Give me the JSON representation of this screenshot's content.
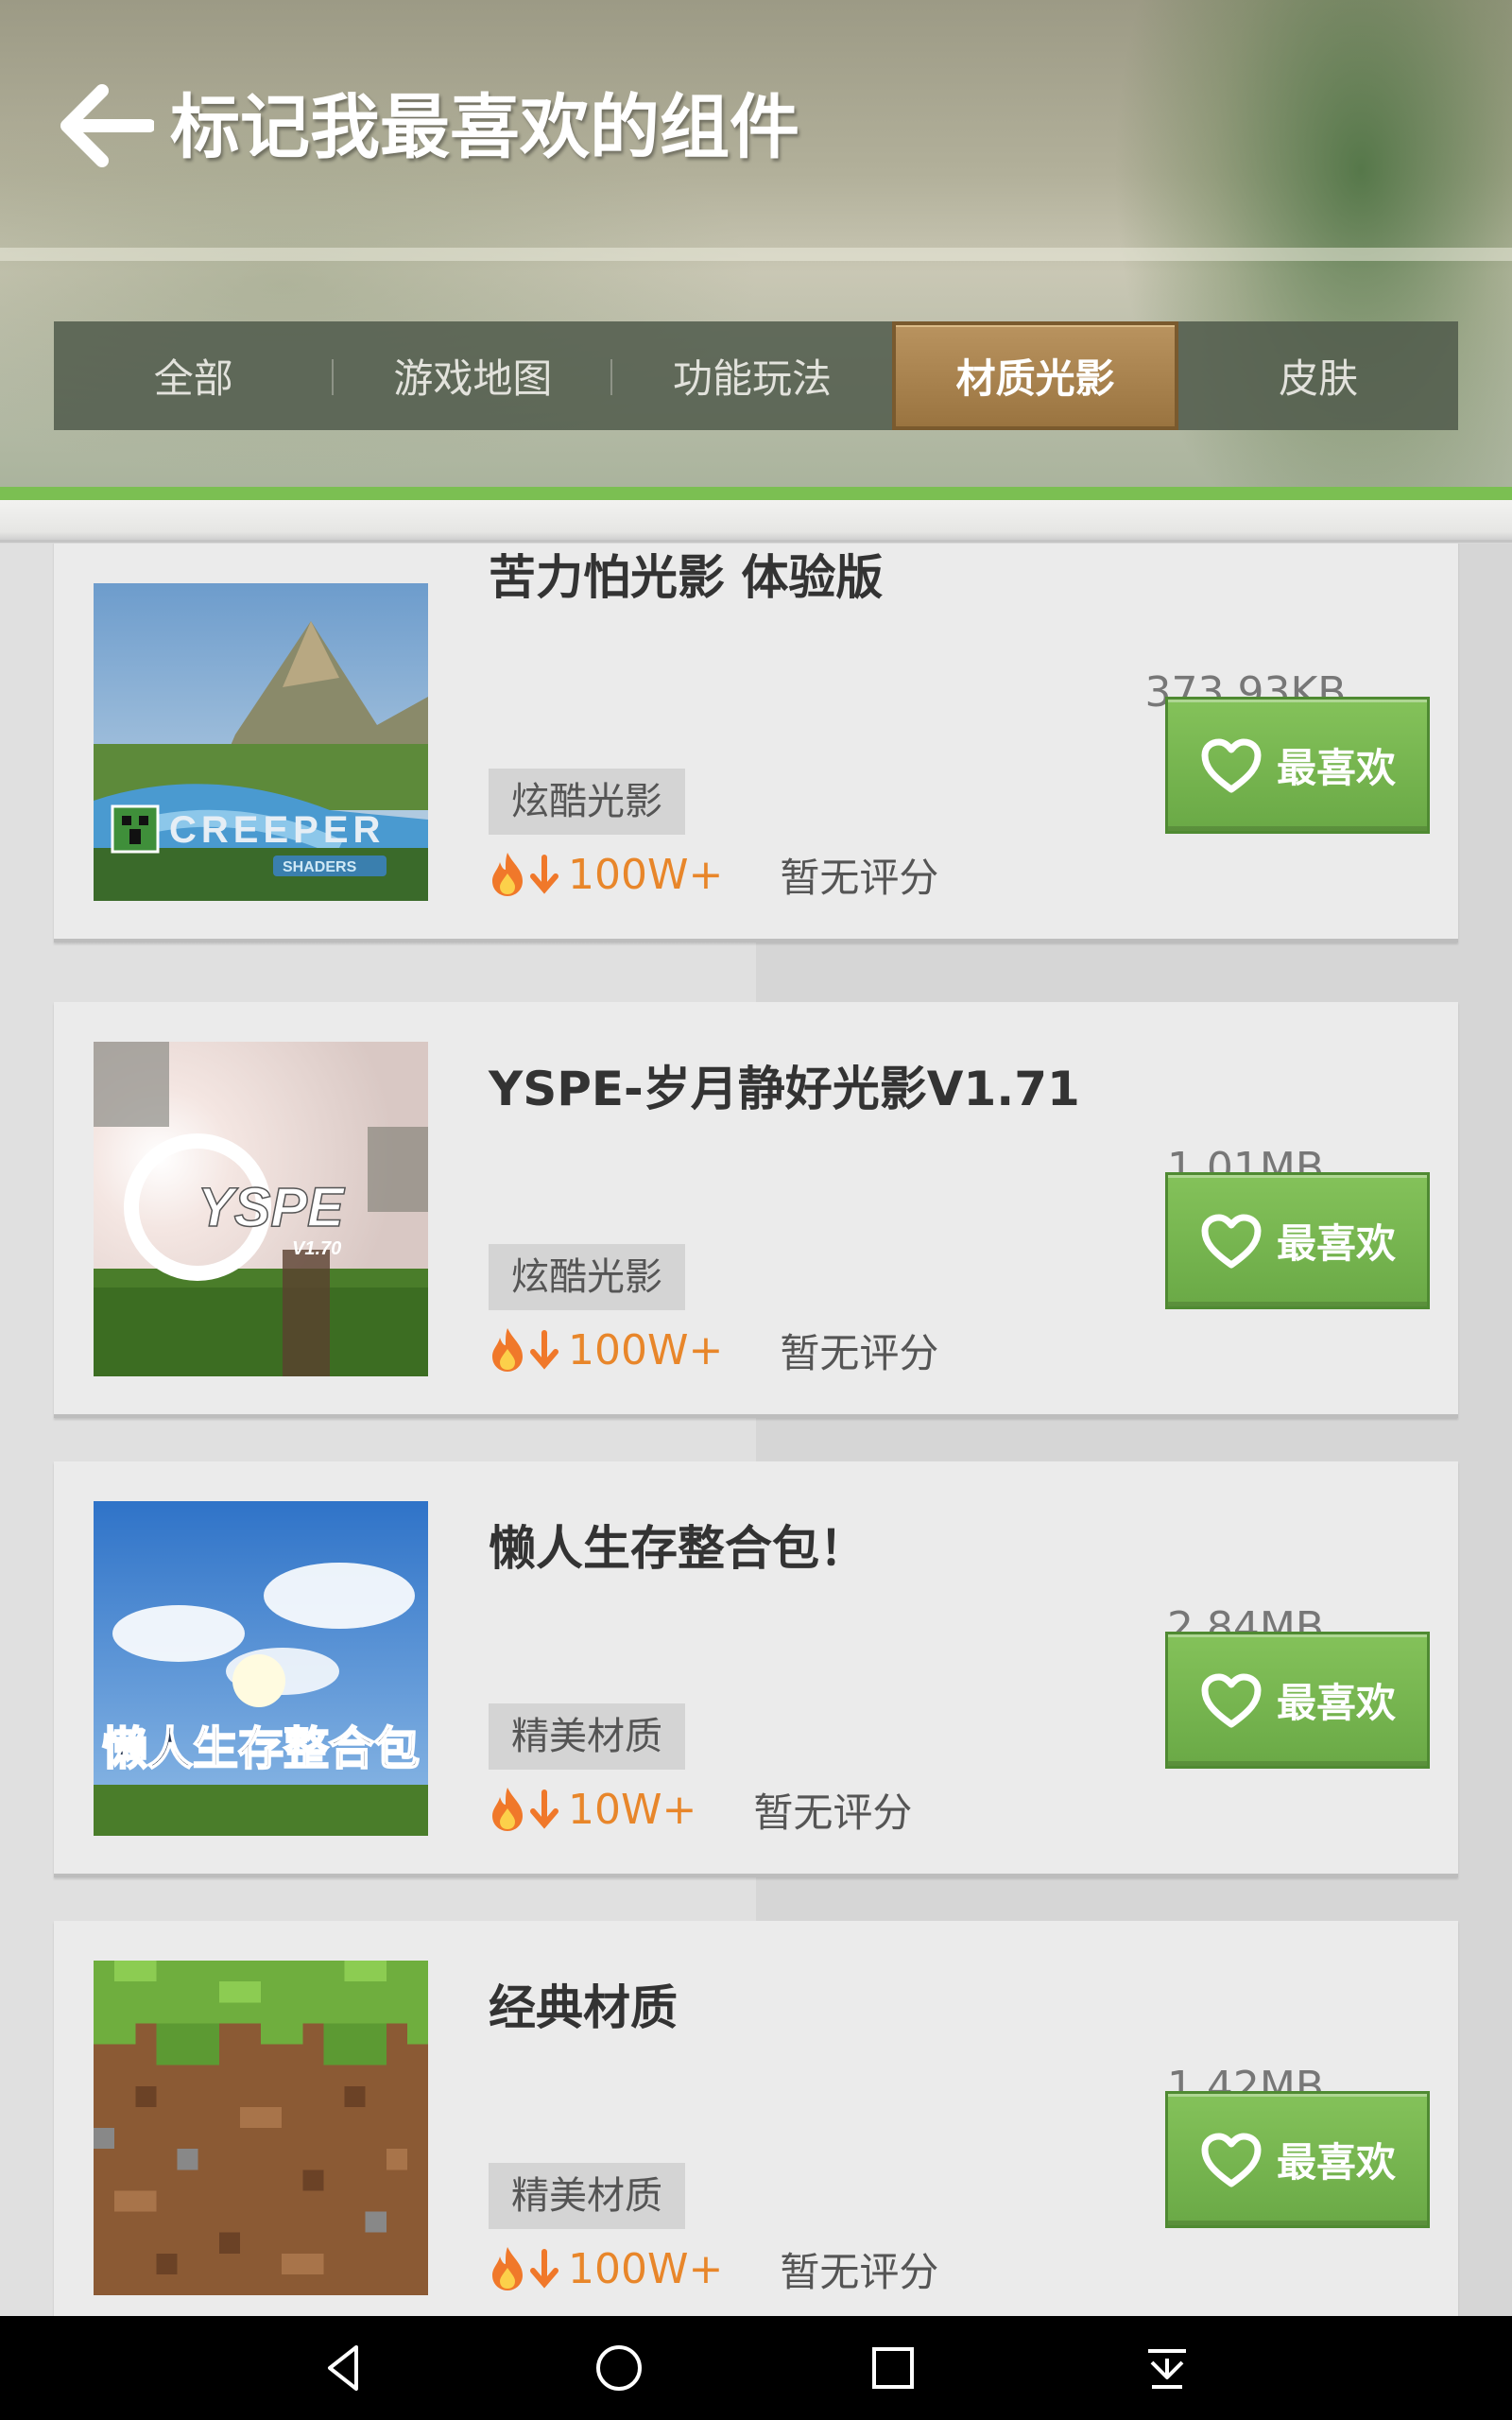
{
  "header": {
    "title": "标记我最喜欢的组件",
    "back_icon": "back-arrow-icon"
  },
  "tabs": [
    {
      "label": "全部",
      "active": false
    },
    {
      "label": "游戏地图",
      "active": false
    },
    {
      "label": "功能玩法",
      "active": false
    },
    {
      "label": "材质光影",
      "active": true
    },
    {
      "label": "皮肤",
      "active": false
    }
  ],
  "items": [
    {
      "title": "苦力怕光影 体验版",
      "size": "373.93KB",
      "tag": "炫酷光影",
      "downloads": "100W+",
      "rating": "暂无评分",
      "button_label": "最喜欢",
      "thumb_text": "CREEPER",
      "thumb_subtext": "SHADERS"
    },
    {
      "title": "YSPE-岁月静好光影V1.71",
      "size": "1.01MB",
      "tag": "炫酷光影",
      "downloads": "100W+",
      "rating": "暂无评分",
      "button_label": "最喜欢",
      "thumb_text": "YSPE",
      "thumb_subtext": "V1.70"
    },
    {
      "title": "懒人生存整合包！",
      "size": "2.84MB",
      "tag": "精美材质",
      "downloads": "10W+",
      "rating": "暂无评分",
      "button_label": "最喜欢",
      "thumb_text": "懒人生存整合包"
    },
    {
      "title": "经典材质",
      "size": "1.42MB",
      "tag": "精美材质",
      "downloads": "100W+",
      "rating": "暂无评分",
      "button_label": "最喜欢"
    }
  ],
  "colors": {
    "accent_green": "#7bbf52",
    "button_green": "#6aa946",
    "active_tab_brown": "#9a7440",
    "download_orange": "#e8862a"
  },
  "navbar": {
    "icons": [
      "nav-back-icon",
      "nav-home-icon",
      "nav-recents-icon",
      "nav-menu-icon"
    ]
  }
}
